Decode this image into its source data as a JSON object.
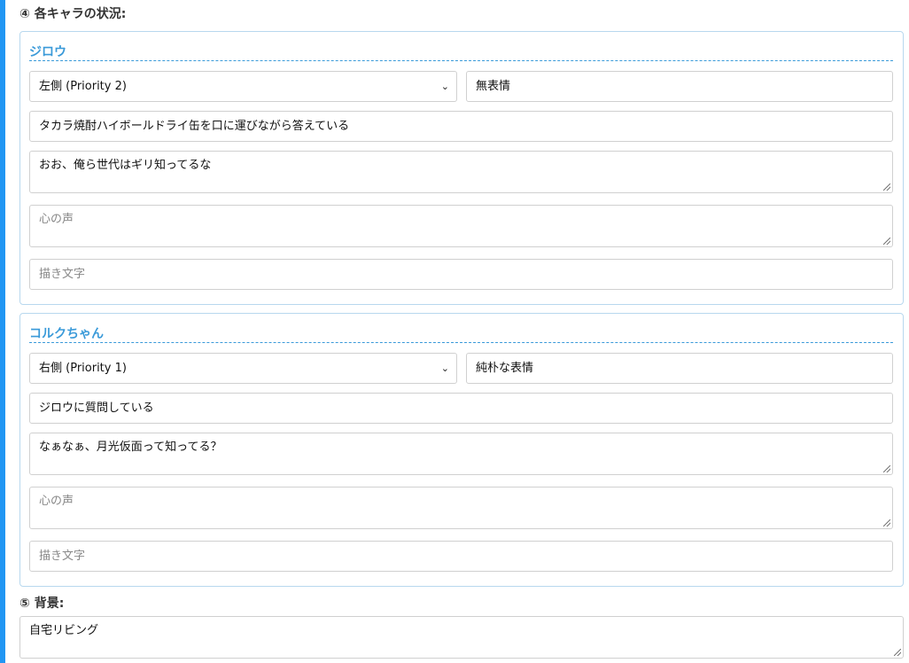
{
  "section4": {
    "title": "④ 各キャラの状況:"
  },
  "characters": [
    {
      "name": "ジロウ",
      "position": "左側 (Priority 2)",
      "expression": "無表情",
      "action": "タカラ焼酎ハイボールドライ缶を口に運びながら答えている",
      "dialogue": "おお、俺ら世代はギリ知ってるな",
      "inner_voice_placeholder": "心の声",
      "drawn_text_placeholder": "描き文字"
    },
    {
      "name": "コルクちゃん",
      "position": "右側 (Priority 1)",
      "expression": "純朴な表情",
      "action": "ジロウに質問している",
      "dialogue": "なぁなぁ、月光仮面って知ってる？",
      "inner_voice_placeholder": "心の声",
      "drawn_text_placeholder": "描き文字"
    }
  ],
  "section5": {
    "title": "⑤ 背景:",
    "value": "自宅リビング"
  },
  "icons": {
    "select_chevron": "⌄"
  },
  "colors": {
    "accent": "#2196f3",
    "character_name": "#3a9ad9",
    "card_border": "#b8d8ee"
  }
}
